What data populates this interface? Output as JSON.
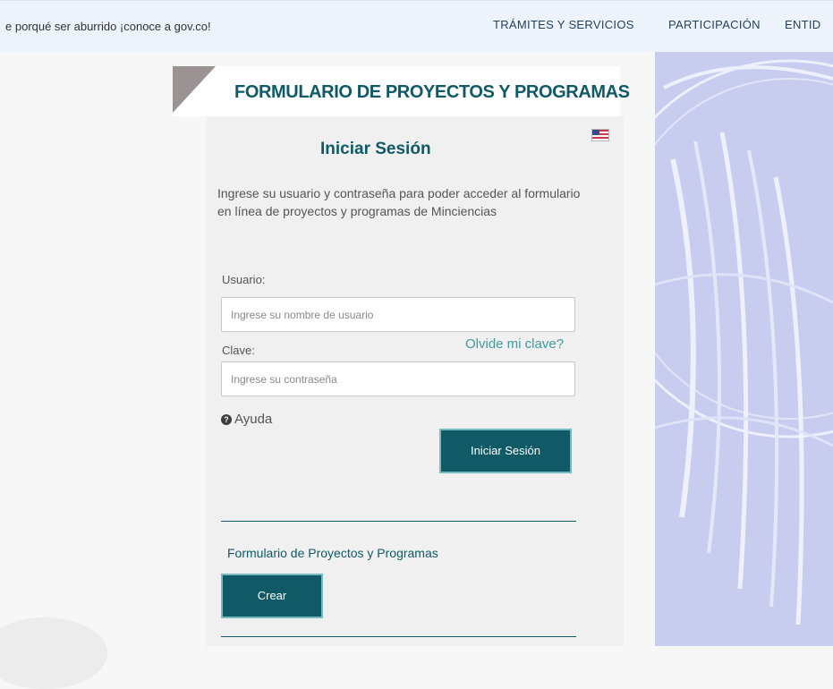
{
  "topbar": {
    "tagline": "e porqué ser aburrido ¡conoce a gov.co!",
    "nav": [
      "TRÁMITES Y SERVICIOS",
      "PARTICIPACIÓN",
      "ENTID"
    ]
  },
  "header": {
    "title": "FORMULARIO DE PROYECTOS Y PROGRAMAS"
  },
  "login": {
    "title": "Iniciar Sesión",
    "description": "Ingrese su usuario y contraseña para poder acceder al formulario en línea de proyectos y programas de Minciencias",
    "user_label": "Usuario:",
    "user_placeholder": "Ingrese su nombre de usuario",
    "pass_label": "Clave:",
    "pass_placeholder": "Ingrese su contraseña",
    "forgot_link": "Olvide mi clave?",
    "help_link": "Ayuda",
    "submit_label": "Iniciar Sesión"
  },
  "projects": {
    "link": "Formulario de Proyectos y Programas",
    "create_label": "Crear"
  },
  "icons": {
    "language": "us-flag-icon",
    "help": "question-circle-icon"
  },
  "colors": {
    "primary": "#0f5a66",
    "link": "#3f9a9e",
    "background_art": "#c8cdf0"
  }
}
